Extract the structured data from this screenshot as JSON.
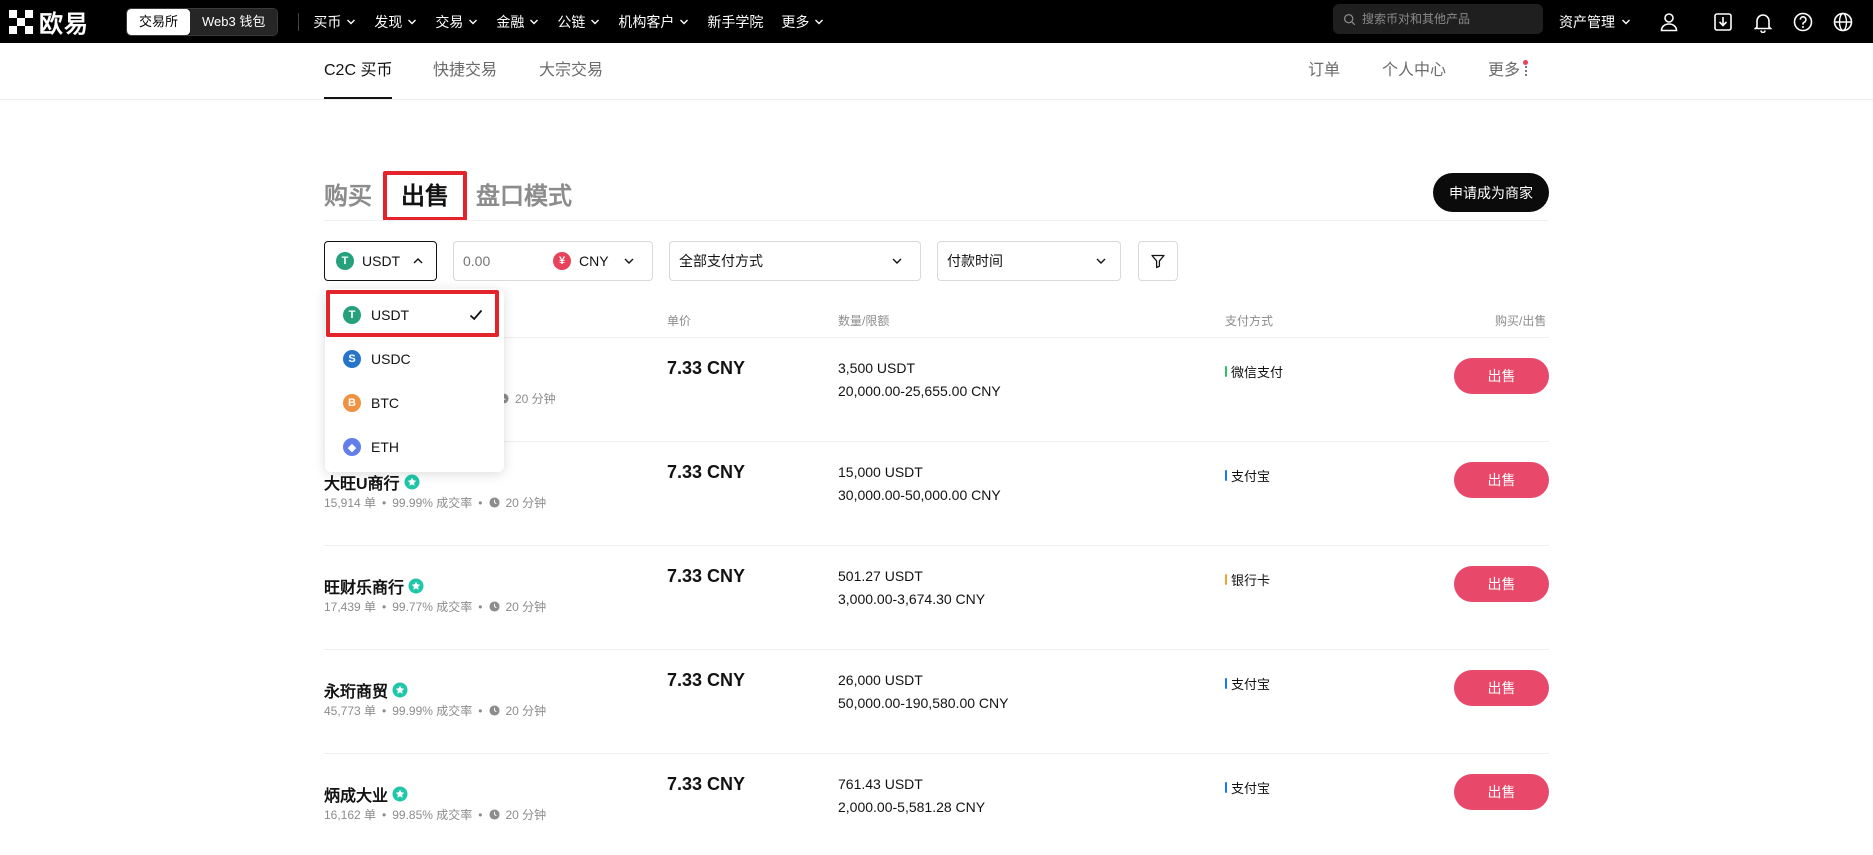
{
  "brand": {
    "name": "欧易"
  },
  "mode_switch": {
    "exchange": "交易所",
    "web3": "Web3 钱包"
  },
  "nav": [
    "买币",
    "发现",
    "交易",
    "金融",
    "公链",
    "机构客户",
    "新手学院",
    "更多"
  ],
  "nav_has_chevron": [
    true,
    true,
    true,
    true,
    true,
    true,
    false,
    true
  ],
  "search": {
    "placeholder": "搜索币对和其他产品"
  },
  "asset_menu": {
    "label": "资产管理"
  },
  "top_icons": [
    "user-icon",
    "download-icon",
    "bell-icon",
    "help-icon",
    "globe-icon"
  ],
  "subnav": {
    "tabs": [
      "C2C 买币",
      "快捷交易",
      "大宗交易"
    ],
    "active_tab": 0,
    "right": {
      "orders": "订单",
      "profile": "个人中心",
      "more": "更多"
    }
  },
  "main_tabs": {
    "buy": "购买",
    "sell": "出售",
    "orderbook": "盘口模式",
    "active": "sell"
  },
  "merchant_button": "申请成为商家",
  "filters": {
    "coin": "USDT",
    "amount_placeholder": "0.00",
    "fiat": "CNY",
    "fiat_symbol": "¥",
    "payment": "全部支付方式",
    "pay_time": "付款时间"
  },
  "coin_dropdown": {
    "items": [
      "USDT",
      "USDC",
      "BTC",
      "ETH"
    ],
    "selected": "USDT"
  },
  "table": {
    "headers": {
      "price": "单价",
      "qty": "数量/限额",
      "payment": "支付方式",
      "action": "购买/出售"
    },
    "rows": [
      {
        "name": "",
        "orders": "",
        "rate": "",
        "time": "20 分钟",
        "price": "7.33 CNY",
        "qty": "3,500 USDT",
        "limit": "20,000.00-25,655.00 CNY",
        "payment": "微信支付",
        "pay_color": "#2bc168",
        "action": "出售"
      },
      {
        "name": "大旺U商行",
        "orders": "15,914 单",
        "rate": "99.99% 成交率",
        "time": "20 分钟",
        "price": "7.33 CNY",
        "qty": "15,000 USDT",
        "limit": "30,000.00-50,000.00 CNY",
        "payment": "支付宝",
        "pay_color": "#1677ff",
        "action": "出售"
      },
      {
        "name": "旺财乐商行",
        "orders": "17,439 单",
        "rate": "99.77% 成交率",
        "time": "20 分钟",
        "price": "7.33 CNY",
        "qty": "501.27 USDT",
        "limit": "3,000.00-3,674.30 CNY",
        "payment": "银行卡",
        "pay_color": "#f0a236",
        "action": "出售"
      },
      {
        "name": "永珩商贸",
        "orders": "45,773 单",
        "rate": "99.99% 成交率",
        "time": "20 分钟",
        "price": "7.33 CNY",
        "qty": "26,000 USDT",
        "limit": "50,000.00-190,580.00 CNY",
        "payment": "支付宝",
        "pay_color": "#1677ff",
        "action": "出售"
      },
      {
        "name": "炳成大业",
        "orders": "16,162 单",
        "rate": "99.85% 成交率",
        "time": "20 分钟",
        "price": "7.33 CNY",
        "qty": "761.43 USDT",
        "limit": "2,000.00-5,581.28 CNY",
        "payment": "支付宝",
        "pay_color": "#1677ff",
        "action": "出售"
      }
    ]
  },
  "colors": {
    "accent": "#e8486a",
    "highlight_box": "#e3242b",
    "verify": "#1fc7a8"
  }
}
